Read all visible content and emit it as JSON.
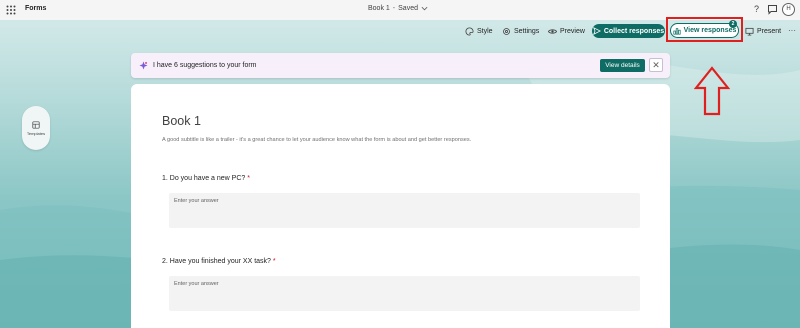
{
  "app": {
    "name": "Forms"
  },
  "document": {
    "title": "Book 1",
    "separator": "-",
    "status": "Saved"
  },
  "topbar": {
    "help_glyph": "?",
    "avatar_initial": "H"
  },
  "toolbar": {
    "style": "Style",
    "settings": "Settings",
    "preview": "Preview",
    "collect": "Collect responses",
    "view_responses": "View responses",
    "responses_count": "2",
    "present": "Present",
    "more_glyph": "···"
  },
  "suggestions": {
    "text": "I have 6 suggestions to your form",
    "action": "View details",
    "close_glyph": "✕"
  },
  "side": {
    "templates_label": "Templates"
  },
  "form": {
    "title": "Book 1",
    "subtitle": "A good subtitle is like a trailer - it's a great chance to let your audience know what the form is about and get better responses.",
    "questions": [
      {
        "label": "1. Do you have a new PC?",
        "required_mark": "*",
        "placeholder": "Enter your answer"
      },
      {
        "label": "2. Have you finished your XX task?",
        "required_mark": "*",
        "placeholder": "Enter your answer"
      }
    ]
  },
  "colors": {
    "accent": "#0f6c64",
    "highlight": "#e0201f",
    "suggestion_bg": "#f7f0fa",
    "background_teal": "#8cc7c6"
  },
  "icons": [
    "waffle-icon",
    "chevron-down-icon",
    "help-icon",
    "chat-icon",
    "style-icon",
    "settings-icon",
    "preview-icon",
    "send-icon",
    "chart-icon",
    "present-icon",
    "more-icon",
    "sparkle-icon",
    "close-icon",
    "templates-icon",
    "arrow-up-icon"
  ]
}
